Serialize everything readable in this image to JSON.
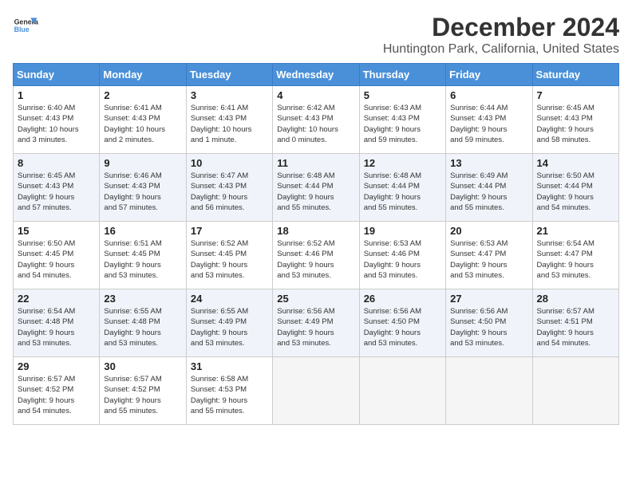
{
  "logo": {
    "text_general": "General",
    "text_blue": "Blue"
  },
  "title": "December 2024",
  "subtitle": "Huntington Park, California, United States",
  "weekdays": [
    "Sunday",
    "Monday",
    "Tuesday",
    "Wednesday",
    "Thursday",
    "Friday",
    "Saturday"
  ],
  "weeks": [
    [
      {
        "day": "1",
        "info": "Sunrise: 6:40 AM\nSunset: 4:43 PM\nDaylight: 10 hours\nand 3 minutes."
      },
      {
        "day": "2",
        "info": "Sunrise: 6:41 AM\nSunset: 4:43 PM\nDaylight: 10 hours\nand 2 minutes."
      },
      {
        "day": "3",
        "info": "Sunrise: 6:41 AM\nSunset: 4:43 PM\nDaylight: 10 hours\nand 1 minute."
      },
      {
        "day": "4",
        "info": "Sunrise: 6:42 AM\nSunset: 4:43 PM\nDaylight: 10 hours\nand 0 minutes."
      },
      {
        "day": "5",
        "info": "Sunrise: 6:43 AM\nSunset: 4:43 PM\nDaylight: 9 hours\nand 59 minutes."
      },
      {
        "day": "6",
        "info": "Sunrise: 6:44 AM\nSunset: 4:43 PM\nDaylight: 9 hours\nand 59 minutes."
      },
      {
        "day": "7",
        "info": "Sunrise: 6:45 AM\nSunset: 4:43 PM\nDaylight: 9 hours\nand 58 minutes."
      }
    ],
    [
      {
        "day": "8",
        "info": "Sunrise: 6:45 AM\nSunset: 4:43 PM\nDaylight: 9 hours\nand 57 minutes."
      },
      {
        "day": "9",
        "info": "Sunrise: 6:46 AM\nSunset: 4:43 PM\nDaylight: 9 hours\nand 57 minutes."
      },
      {
        "day": "10",
        "info": "Sunrise: 6:47 AM\nSunset: 4:43 PM\nDaylight: 9 hours\nand 56 minutes."
      },
      {
        "day": "11",
        "info": "Sunrise: 6:48 AM\nSunset: 4:44 PM\nDaylight: 9 hours\nand 55 minutes."
      },
      {
        "day": "12",
        "info": "Sunrise: 6:48 AM\nSunset: 4:44 PM\nDaylight: 9 hours\nand 55 minutes."
      },
      {
        "day": "13",
        "info": "Sunrise: 6:49 AM\nSunset: 4:44 PM\nDaylight: 9 hours\nand 55 minutes."
      },
      {
        "day": "14",
        "info": "Sunrise: 6:50 AM\nSunset: 4:44 PM\nDaylight: 9 hours\nand 54 minutes."
      }
    ],
    [
      {
        "day": "15",
        "info": "Sunrise: 6:50 AM\nSunset: 4:45 PM\nDaylight: 9 hours\nand 54 minutes."
      },
      {
        "day": "16",
        "info": "Sunrise: 6:51 AM\nSunset: 4:45 PM\nDaylight: 9 hours\nand 53 minutes."
      },
      {
        "day": "17",
        "info": "Sunrise: 6:52 AM\nSunset: 4:45 PM\nDaylight: 9 hours\nand 53 minutes."
      },
      {
        "day": "18",
        "info": "Sunrise: 6:52 AM\nSunset: 4:46 PM\nDaylight: 9 hours\nand 53 minutes."
      },
      {
        "day": "19",
        "info": "Sunrise: 6:53 AM\nSunset: 4:46 PM\nDaylight: 9 hours\nand 53 minutes."
      },
      {
        "day": "20",
        "info": "Sunrise: 6:53 AM\nSunset: 4:47 PM\nDaylight: 9 hours\nand 53 minutes."
      },
      {
        "day": "21",
        "info": "Sunrise: 6:54 AM\nSunset: 4:47 PM\nDaylight: 9 hours\nand 53 minutes."
      }
    ],
    [
      {
        "day": "22",
        "info": "Sunrise: 6:54 AM\nSunset: 4:48 PM\nDaylight: 9 hours\nand 53 minutes."
      },
      {
        "day": "23",
        "info": "Sunrise: 6:55 AM\nSunset: 4:48 PM\nDaylight: 9 hours\nand 53 minutes."
      },
      {
        "day": "24",
        "info": "Sunrise: 6:55 AM\nSunset: 4:49 PM\nDaylight: 9 hours\nand 53 minutes."
      },
      {
        "day": "25",
        "info": "Sunrise: 6:56 AM\nSunset: 4:49 PM\nDaylight: 9 hours\nand 53 minutes."
      },
      {
        "day": "26",
        "info": "Sunrise: 6:56 AM\nSunset: 4:50 PM\nDaylight: 9 hours\nand 53 minutes."
      },
      {
        "day": "27",
        "info": "Sunrise: 6:56 AM\nSunset: 4:50 PM\nDaylight: 9 hours\nand 53 minutes."
      },
      {
        "day": "28",
        "info": "Sunrise: 6:57 AM\nSunset: 4:51 PM\nDaylight: 9 hours\nand 54 minutes."
      }
    ],
    [
      {
        "day": "29",
        "info": "Sunrise: 6:57 AM\nSunset: 4:52 PM\nDaylight: 9 hours\nand 54 minutes."
      },
      {
        "day": "30",
        "info": "Sunrise: 6:57 AM\nSunset: 4:52 PM\nDaylight: 9 hours\nand 55 minutes."
      },
      {
        "day": "31",
        "info": "Sunrise: 6:58 AM\nSunset: 4:53 PM\nDaylight: 9 hours\nand 55 minutes."
      },
      {
        "day": "",
        "info": ""
      },
      {
        "day": "",
        "info": ""
      },
      {
        "day": "",
        "info": ""
      },
      {
        "day": "",
        "info": ""
      }
    ]
  ]
}
